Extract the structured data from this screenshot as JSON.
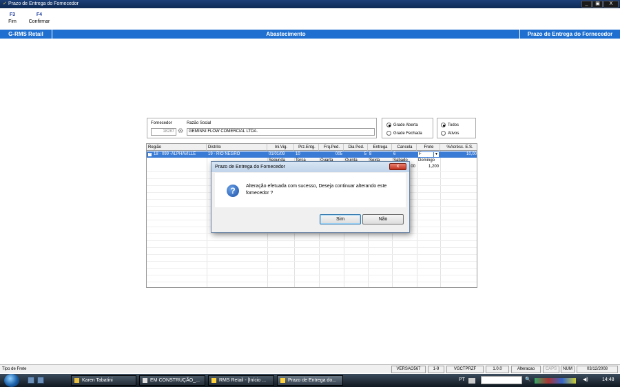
{
  "window": {
    "title": "Prazo de Entrega do Fornecedor",
    "controls": [
      "_",
      "▣",
      "X"
    ]
  },
  "toolbar": [
    {
      "key": "F3",
      "label": "Fim"
    },
    {
      "key": "F4",
      "label": "Confirmar"
    }
  ],
  "header": {
    "left": "G-RMS Retail",
    "center": "Abastecimento",
    "right": "Prazo de Entrega do Fornecedor"
  },
  "form": {
    "fornecedor_label": "Fornecedor",
    "razao_label": "Razão Social",
    "fornecedor_value": "18287",
    "razao_value": "GEMINNI FLOW COMERCIAL LTDA."
  },
  "grade_radios": [
    {
      "label": "Grade Aberta",
      "checked": true
    },
    {
      "label": "Grade Fechada",
      "checked": false
    }
  ],
  "filter_radios": [
    {
      "label": "Todos",
      "checked": true
    },
    {
      "label": "Ativos",
      "checked": false
    }
  ],
  "grid": {
    "columns": [
      "Região",
      "Distrito",
      "Ini.Vig.",
      "Prz.Entg.",
      "Frq.Ped.",
      "Dia Ped.",
      "Entrega",
      "Cancela",
      "Frete",
      "%Acrésc. E.S."
    ],
    "row": [
      "18 - 099 -ALPHAVILLE",
      "19 - RIO NEGRO",
      "01/01/09",
      "10",
      "005",
      "5",
      "8",
      "6",
      "F",
      "10,00"
    ],
    "subheaders": [
      "Segunda",
      "Terça",
      "Quarta",
      "Quinta",
      "Sexta",
      "Sabado",
      "Domingo"
    ],
    "subvalues": [
      "00",
      "1,200"
    ]
  },
  "dialog": {
    "title": "Prazo de Entrega do Fornecedor",
    "close": "x",
    "message": "Alteração efetuada com sucesso, Deseja continuar alterando este fornecedor ?",
    "yes": "Sim",
    "no": "Não"
  },
  "status": {
    "text": "Tipo de Frete",
    "cells": [
      "VERSAO567",
      "1-9",
      "VGCTPRZF",
      "1.0.0",
      "Alteracao",
      "CAPS",
      "NUM",
      "03/12/2008"
    ]
  },
  "taskbar": {
    "tasks": [
      "Karen Tabatini",
      "EM CONSTRUÇÃO_...",
      "RMS Retail - [Início ...",
      "Prazo de Entrega do..."
    ],
    "lang": "PT",
    "time": "14:48"
  }
}
